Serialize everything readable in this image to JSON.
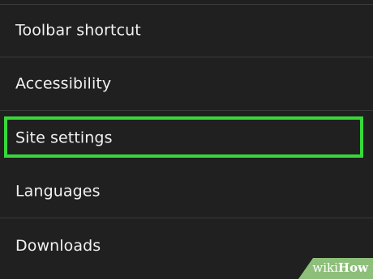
{
  "settings": {
    "items": [
      {
        "label": "Toolbar shortcut"
      },
      {
        "label": "Accessibility"
      },
      {
        "label": "Site settings",
        "highlighted": true
      },
      {
        "label": "Languages"
      },
      {
        "label": "Downloads"
      }
    ]
  },
  "highlight": {
    "color": "#38d83a"
  },
  "watermark": {
    "part1": "wiki",
    "part2": "How",
    "background": "#8dbf7a"
  }
}
